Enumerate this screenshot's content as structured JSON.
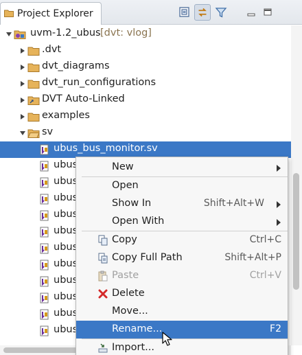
{
  "view": {
    "title": "Project Explorer",
    "toolbar": {
      "collapse_all": "collapse-all-icon",
      "link_editor": "link-with-editor-icon",
      "filter": "filter-icon",
      "minimize": "minimize-icon",
      "maximize": "maximize-icon"
    }
  },
  "tree": {
    "project": {
      "name": "uvm-1.2_ubus",
      "decoration": "[dvt: vlog]"
    },
    "folders": [
      ".dvt",
      "dvt_diagrams",
      "dvt_run_configurations",
      "DVT Auto-Linked",
      "examples",
      "sv"
    ],
    "selected_file": "ubus_bus_monitor.sv",
    "files": [
      "ubus",
      "ubus",
      "ubus",
      "ubus",
      "ubus",
      "ubus",
      "ubus",
      "ubus",
      "ubus",
      "ubus",
      "ubus"
    ]
  },
  "context_menu": {
    "items": [
      {
        "label": "New",
        "shortcut": "",
        "submenu": true
      },
      {
        "label": "Open",
        "shortcut": ""
      },
      {
        "label": "Show In",
        "shortcut": "Shift+Alt+W",
        "submenu": true
      },
      {
        "label": "Open With",
        "shortcut": "",
        "submenu": true
      },
      {
        "label": "Copy",
        "shortcut": "Ctrl+C",
        "icon": "copy-icon"
      },
      {
        "label": "Copy Full Path",
        "shortcut": "Shift+Alt+P",
        "icon": "copy-path-icon"
      },
      {
        "label": "Paste",
        "shortcut": "Ctrl+V",
        "icon": "paste-icon",
        "disabled": true
      },
      {
        "label": "Delete",
        "shortcut": "",
        "icon": "delete-icon"
      },
      {
        "label": "Move...",
        "shortcut": ""
      },
      {
        "label": "Rename...",
        "shortcut": "F2",
        "highlighted": true
      },
      {
        "label": "Import...",
        "shortcut": "",
        "icon": "import-icon"
      }
    ]
  },
  "colors": {
    "selection": "#3b78c6",
    "folder": "#e0a94a",
    "decoration": "#8a7450"
  }
}
